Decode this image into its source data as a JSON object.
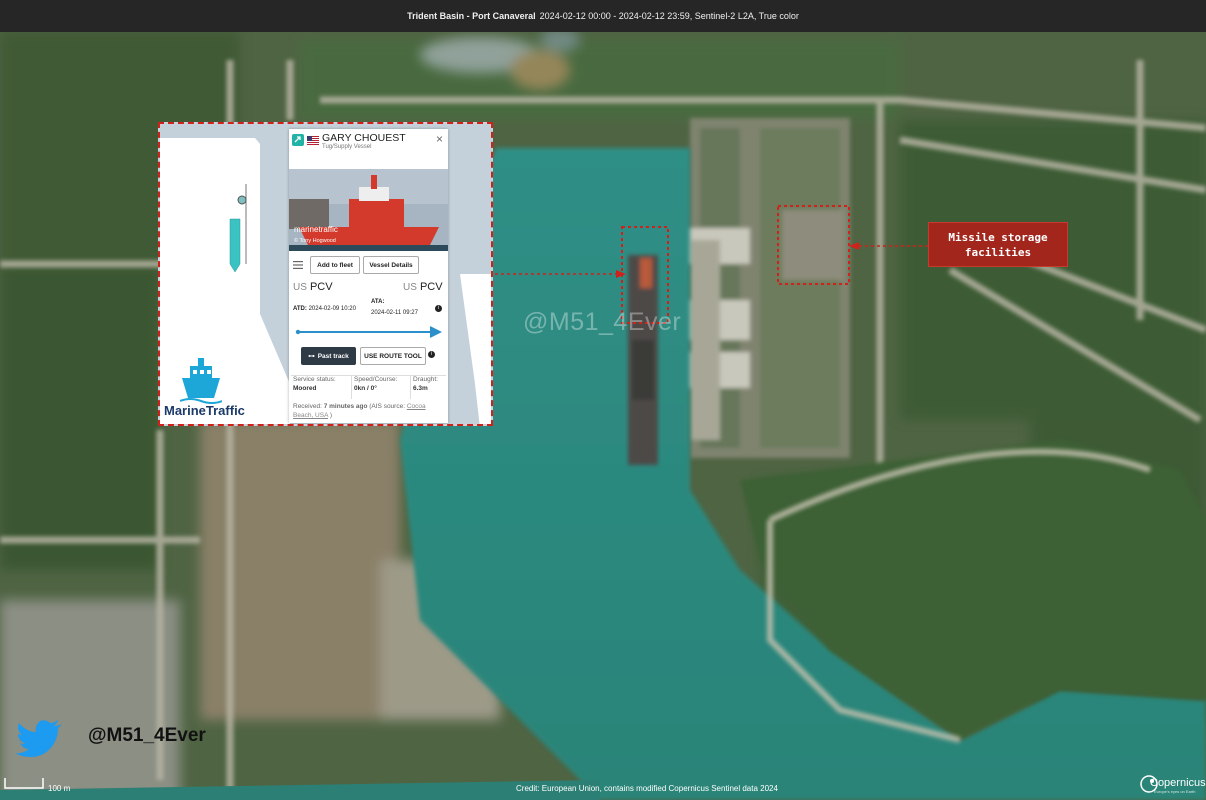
{
  "header": {
    "location": "Trident Basin - Port Canaveral",
    "details": "2024-02-12 00:00 - 2024-02-12 23:59, Sentinel-2 L2A, True color"
  },
  "watermark": "@M51_4Ever",
  "callout": {
    "line1": "Missile storage",
    "line2": "facilities"
  },
  "inset": {
    "brand": "MarineTraffic",
    "vessel_name": "GARY CHOUEST",
    "vessel_type": "Tug/Supply Vessel",
    "photo_brand": "marinetraffic",
    "photo_credit": "© Tony Hogwood",
    "add_to_fleet": "Add to fleet",
    "vessel_details": "Vessel Details",
    "departure_country": "US",
    "departure_port": "PCV",
    "arrival_country": "US",
    "arrival_port": "PCV",
    "atd_label": "ATD:",
    "atd_value": "2024-02-09 10:20",
    "ata_label": "ATA:",
    "ata_value": "2024-02-11 09:27",
    "past_track": "Past track",
    "route_tool": "USE ROUTE TOOL",
    "service_status_label": "Service status:",
    "service_status_value": "Moored",
    "speed_course_label": "Speed/Course:",
    "speed_course_value": "0kn / 0°",
    "draught_label": "Draught:",
    "draught_value": "6.3m",
    "received_label": "Received:",
    "received_value": "7 minutes ago",
    "ais_source_label": "(AIS source:",
    "ais_source_value": "Cocoa Beach, USA",
    "ais_source_close": ")"
  },
  "twitter_handle": "@M51_4Ever",
  "scale_label": "100 m",
  "credit": "Credit: European Union, contains modified Copernicus Sentinel data 2024",
  "copernicus": {
    "word": "Copernicus",
    "tagline": "Europe's eyes on Earth"
  },
  "colors": {
    "highlight": "#d0211b",
    "callout_bg": "#a3261d",
    "water": "#2d8a7e",
    "twitter": "#1d9bf0",
    "marinetraffic_blue": "#1b3a68"
  },
  "icons": [
    "twitter-bird-icon",
    "ship-icon",
    "link-icon",
    "us-flag-icon",
    "close-icon",
    "menu-icon",
    "info-icon",
    "copernicus-logo-icon"
  ]
}
